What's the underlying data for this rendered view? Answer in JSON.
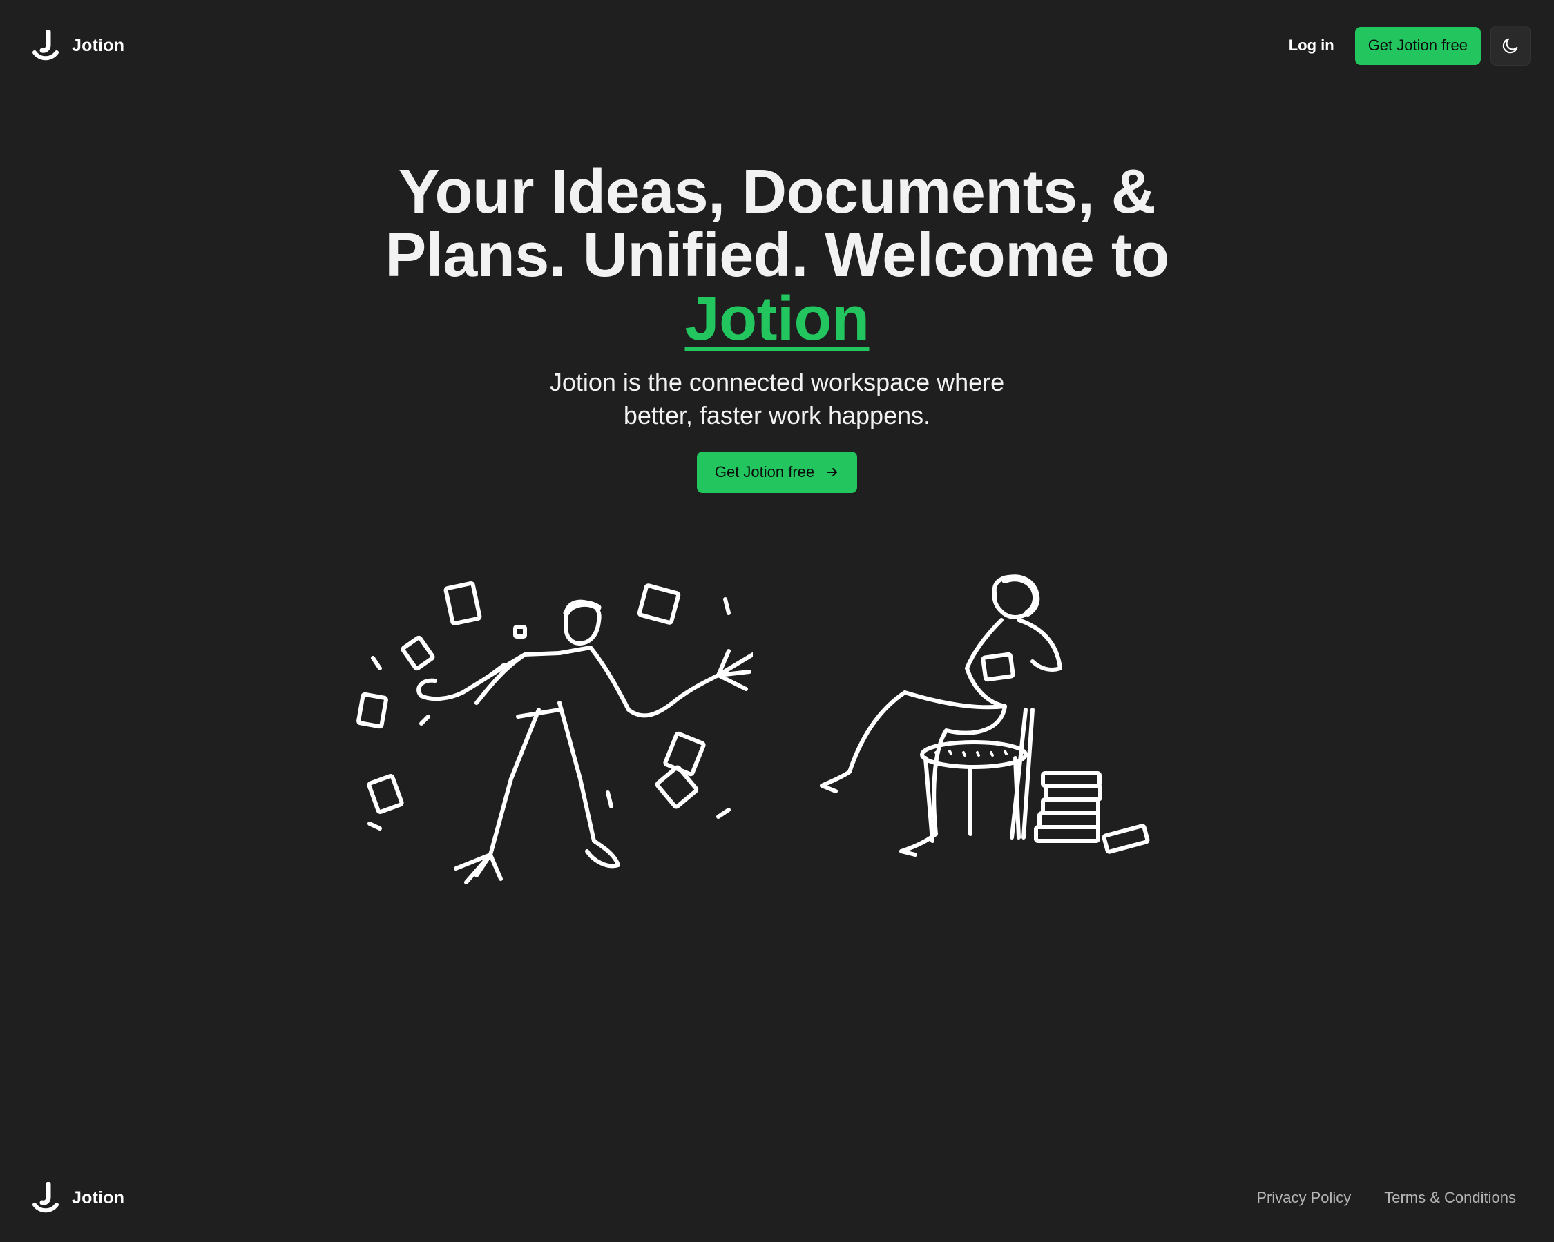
{
  "app": {
    "name": "Jotion"
  },
  "colors": {
    "background": "#1f1f1f",
    "accent": "#22c55e",
    "text": "#f2f2f2",
    "muted": "#b5b5b5"
  },
  "navbar": {
    "login_label": "Log in",
    "cta_label": "Get Jotion free",
    "theme_toggle_icon": "moon-icon"
  },
  "hero": {
    "headline_part1": "Your Ideas, Documents, & Plans. Unified. Welcome to ",
    "headline_highlight": "Jotion",
    "subheading": "Jotion is the connected workspace where better, faster work happens.",
    "cta_label": "Get Jotion free",
    "cta_icon": "arrow-right-icon"
  },
  "illustrations": [
    {
      "name": "man-juggling-papers-illustration"
    },
    {
      "name": "woman-reading-in-chair-illustration"
    }
  ],
  "footer": {
    "brand_name": "Jotion",
    "links": [
      "Privacy Policy",
      "Terms & Conditions"
    ]
  }
}
